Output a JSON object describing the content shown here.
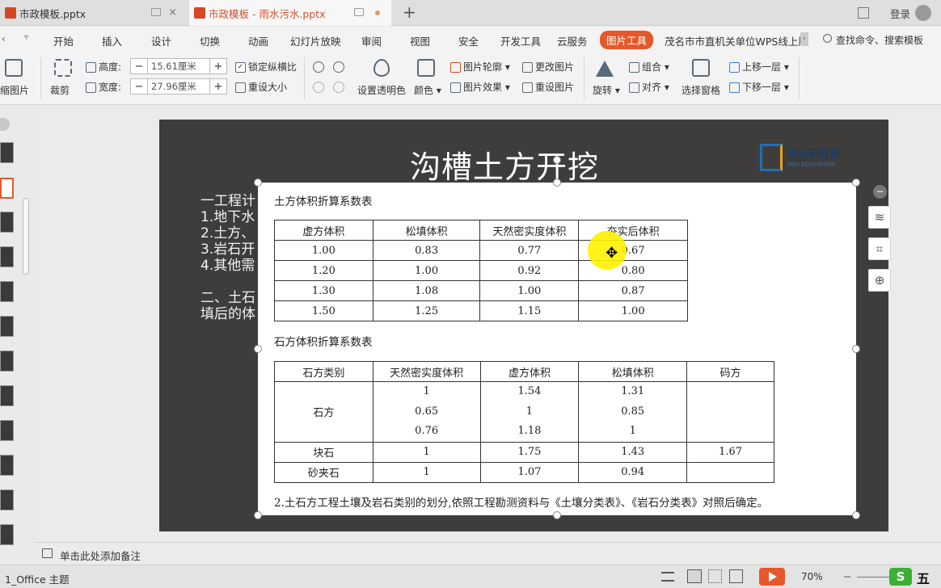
{
  "tabs": [
    {
      "label": "市政模板.pptx"
    },
    {
      "label": "市政模板 - 雨水污水.pptx"
    }
  ],
  "login": "登录",
  "menu": {
    "items": [
      "开始",
      "插入",
      "设计",
      "切换",
      "动画",
      "幻灯片放映",
      "审阅",
      "视图",
      "安全",
      "开发工具",
      "云服务",
      "图片工具",
      "茂名市市直机关单位WPS线上肜"
    ],
    "search": "查找命令、搜索模板"
  },
  "ribbon": {
    "compress": "压缩图片",
    "crop": "裁剪",
    "height_label": "高度:",
    "height_value": "15.61厘米",
    "width_label": "宽度:",
    "width_value": "27.96厘米",
    "lock_ratio": "锁定纵横比",
    "reset_size": "重设大小",
    "transparent": "设置透明色",
    "color": "颜色",
    "outline": "图片轮廓",
    "effect": "图片效果",
    "change_pic": "更改图片",
    "reset_pic": "重设图片",
    "rotate": "旋转",
    "group": "组合",
    "align": "对齐",
    "selection_pane": "选择窗格",
    "bring_forward": "上移一层",
    "send_backward": "下移一层"
  },
  "slide": {
    "title": "沟槽土方开挖",
    "logo_text": "专业职教育",
    "logo_sub": "EDU EDUCATION",
    "lines": [
      "一工程计",
      "1.地下水",
      "2.土方、",
      "3.岩石开",
      "4.其他需",
      "二、土石",
      "填后的体"
    ]
  },
  "table1": {
    "caption": "土方体积折算系数表",
    "headers": [
      "虚方体积",
      "松填体积",
      "天然密实度体积",
      "夯实后体积"
    ],
    "rows": [
      [
        "1.00",
        "0.83",
        "0.77",
        "0.67"
      ],
      [
        "1.20",
        "1.00",
        "0.92",
        "0.80"
      ],
      [
        "1.30",
        "1.08",
        "1.00",
        "0.87"
      ],
      [
        "1.50",
        "1.25",
        "1.15",
        "1.00"
      ]
    ]
  },
  "table2": {
    "caption": "石方体积折算系数表",
    "headers": [
      "石方类别",
      "天然密实度体积",
      "虚方体积",
      "松填体积",
      "码方"
    ],
    "shifang": {
      "label": "石方",
      "natural": [
        "1",
        "0.65",
        "0.76"
      ],
      "loose": [
        "1.54",
        "1",
        "1.18"
      ],
      "fill": [
        "1.31",
        "0.85",
        "1"
      ]
    },
    "rows": [
      [
        "块石",
        "1",
        "1.75",
        "1.43",
        "1.67"
      ],
      [
        "砂夹石",
        "1",
        "1.07",
        "0.94",
        ""
      ]
    ]
  },
  "footnote": "2.土石方工程土壤及岩石类别的划分,依照工程勘测资料与《土壤分类表》、《岩石分类表》对照后确定。",
  "notes_placeholder": "单击此处添加备注",
  "status": {
    "theme": "1_Office 主题",
    "zoom": "70%",
    "ime": "五"
  },
  "colors": {
    "accent": "#e4582b",
    "slide_bg": "#3e3d3b"
  }
}
